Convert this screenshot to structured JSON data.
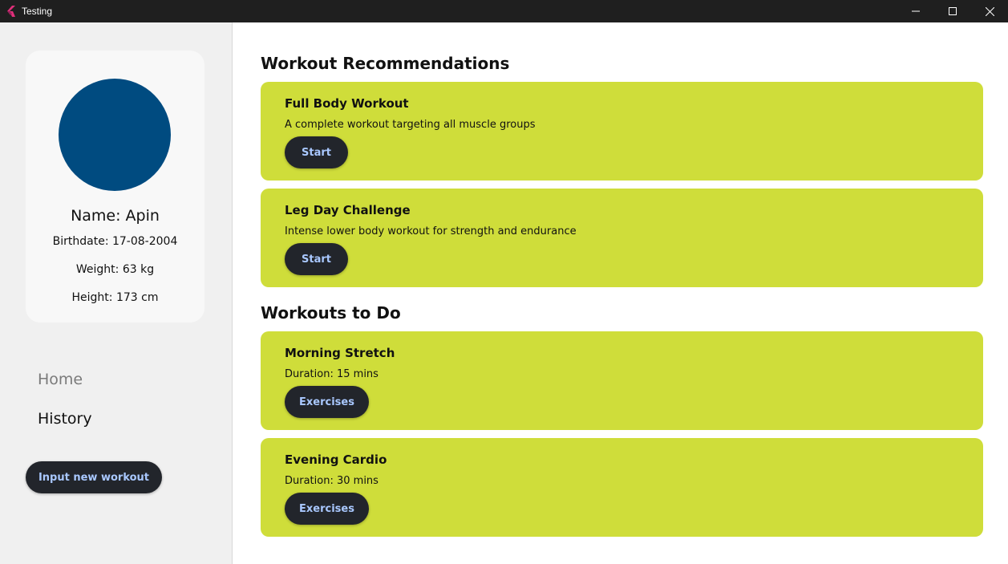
{
  "window": {
    "title": "Testing"
  },
  "profile": {
    "name": "Name: Apin",
    "birthdate": "Birthdate: 17-08-2004",
    "weight": "Weight: 63 kg",
    "height": "Height: 173 cm",
    "avatar_color": "#004b80"
  },
  "nav": {
    "home": "Home",
    "history": "History"
  },
  "input_button": "Input new workout",
  "recommendations": {
    "title": "Workout Recommendations",
    "items": [
      {
        "title": "Full Body Workout",
        "description": "A complete workout targeting all muscle groups",
        "button": "Start"
      },
      {
        "title": "Leg Day Challenge",
        "description": "Intense lower body workout for strength and endurance",
        "button": "Start"
      }
    ]
  },
  "todo": {
    "title": "Workouts to Do",
    "items": [
      {
        "title": "Morning Stretch",
        "duration": "Duration: 15 mins",
        "button": "Exercises"
      },
      {
        "title": "Evening Cardio",
        "duration": "Duration: 30 mins",
        "button": "Exercises"
      }
    ]
  },
  "colors": {
    "card": "#cfdd3a",
    "button": "#22252b",
    "button_text": "#a9c8ff"
  }
}
